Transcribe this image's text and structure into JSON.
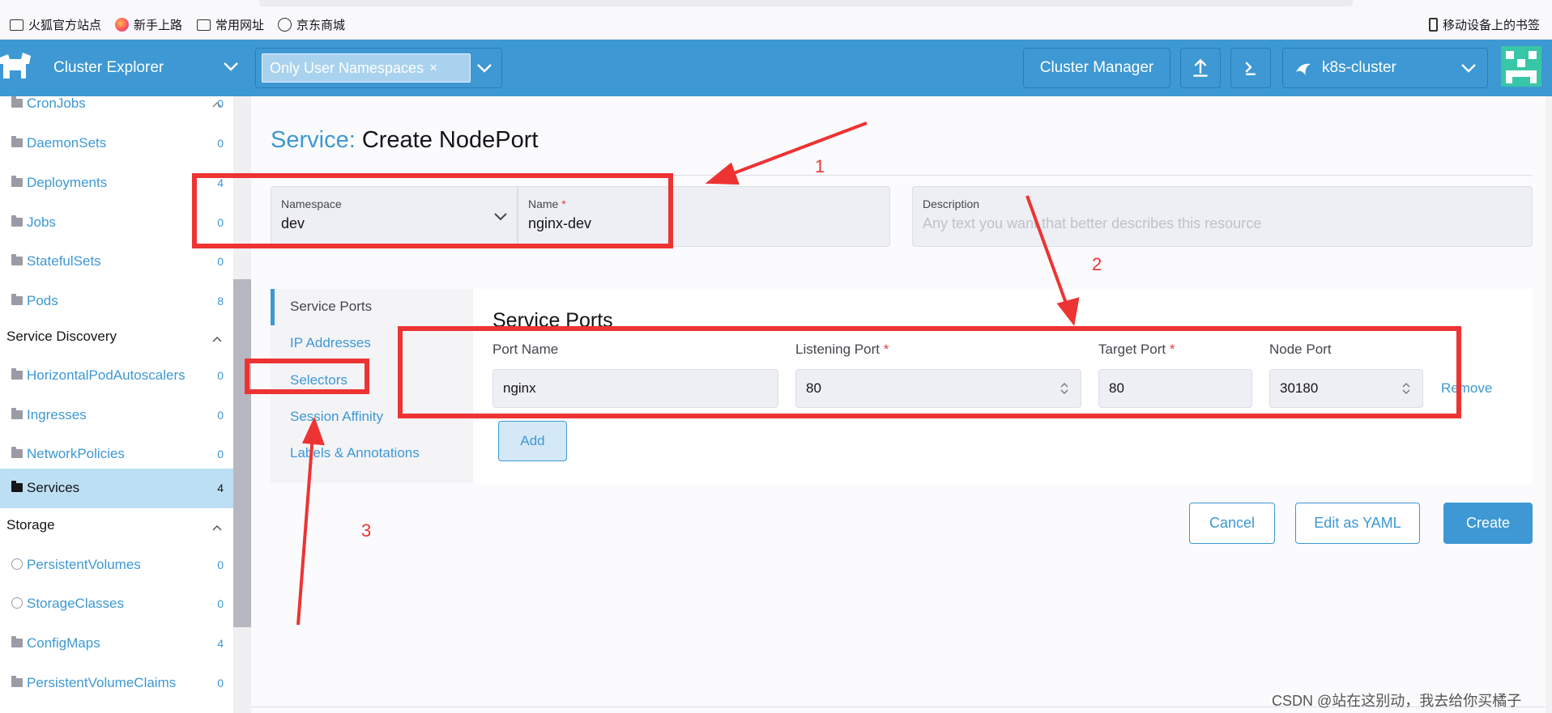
{
  "bookmarks": [
    {
      "label": "火狐官方站点",
      "icon": "folder-icon"
    },
    {
      "label": "新手上路",
      "icon": "firefox-icon"
    },
    {
      "label": "常用网址",
      "icon": "folder-icon"
    },
    {
      "label": "京东商城",
      "icon": "globe-icon"
    }
  ],
  "mobile_bookmarks": "移动设备上的书签",
  "header": {
    "title": "Cluster Explorer",
    "namespace_filter": "Only User Namespaces",
    "namespace_remove": "×",
    "cluster_manager": "Cluster Manager",
    "cluster_name": "k8s-cluster"
  },
  "colors": {
    "accent": "#3d98d3",
    "annotation": "#ee3333",
    "active_bg": "#bcdff3"
  },
  "sidebar": {
    "workloads": [
      {
        "label": "CronJobs",
        "count": "0"
      },
      {
        "label": "DaemonSets",
        "count": "0"
      },
      {
        "label": "Deployments",
        "count": "4"
      },
      {
        "label": "Jobs",
        "count": "0"
      },
      {
        "label": "StatefulSets",
        "count": "0"
      },
      {
        "label": "Pods",
        "count": "8"
      }
    ],
    "service_discovery": {
      "title": "Service Discovery",
      "items": [
        {
          "label": "HorizontalPodAutoscalers",
          "count": "0"
        },
        {
          "label": "Ingresses",
          "count": "0"
        },
        {
          "label": "NetworkPolicies",
          "count": "0"
        },
        {
          "label": "Services",
          "count": "4"
        }
      ]
    },
    "storage": {
      "title": "Storage",
      "items": [
        {
          "label": "PersistentVolumes",
          "count": "0"
        },
        {
          "label": "StorageClasses",
          "count": "0"
        },
        {
          "label": "ConfigMaps",
          "count": "4"
        },
        {
          "label": "PersistentVolumeClaims",
          "count": "0"
        }
      ]
    }
  },
  "page": {
    "title_prefix": "Service:",
    "title": "Create NodePort",
    "namespace_label": "Namespace",
    "namespace_value": "dev",
    "name_label": "Name",
    "name_value": "nginx-dev",
    "description_label": "Description",
    "description_placeholder": "Any text you want that better describes this resource",
    "required_mark": "*"
  },
  "tabs": [
    "Service Ports",
    "IP Addresses",
    "Selectors",
    "Session Affinity",
    "Labels & Annotations"
  ],
  "service_ports": {
    "title": "Service Ports",
    "columns": {
      "port_name": "Port Name",
      "listening_port": "Listening Port",
      "target_port": "Target Port",
      "node_port": "Node Port"
    },
    "row": {
      "port_name": "nginx",
      "listening_port": "80",
      "target_port": "80",
      "node_port": "30180"
    },
    "remove": "Remove",
    "add": "Add"
  },
  "actions": {
    "cancel": "Cancel",
    "edit_yaml": "Edit as YAML",
    "create": "Create"
  },
  "annotations": [
    "1",
    "2",
    "3"
  ],
  "watermark": "CSDN @站在这别动，我去给你买橘子"
}
